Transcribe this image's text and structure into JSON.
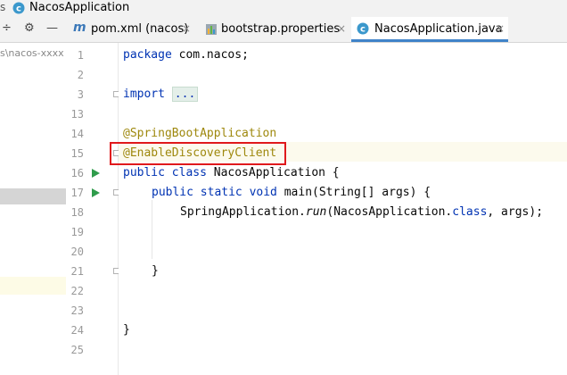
{
  "breadcrumb": {
    "separator": "s",
    "class_name": "NacosApplication"
  },
  "tabs": [
    {
      "label": "pom.xml (nacos)",
      "icon": "maven-m-icon",
      "close": "×"
    },
    {
      "label": "bootstrap.properties",
      "icon": "properties-file-icon",
      "close": "×"
    },
    {
      "label": "NacosApplication.java",
      "icon": "java-class-icon",
      "close": "×",
      "active": true
    }
  ],
  "toolbar": {
    "collapse_glyph": "÷",
    "settings_glyph": "⚙",
    "minimize_glyph": "—"
  },
  "project": {
    "path": "s\\nacos-xxxx"
  },
  "gutter": {
    "line_numbers": [
      "1",
      "2",
      "3",
      "13",
      "14",
      "15",
      "16",
      "17",
      "18",
      "19",
      "20",
      "21",
      "22",
      "23",
      "24",
      "25"
    ]
  },
  "code": {
    "l1_kw": "package",
    "l1_rest": " com.nacos;",
    "l3_kw": "import",
    "l3_fold": "...",
    "l14_ann": "@SpringBootApplication",
    "l15_ann": "@EnableDiscoveryClient",
    "l16_kw": "public class",
    "l16_rest": " NacosApplication {",
    "l17_kw": "public static void",
    "l17_rest": " main(String[] args) {",
    "l18_a": "SpringApplication.",
    "l18_run": "run",
    "l18_b": "(NacosApplication.",
    "l18_class": "class",
    "l18_c": ", args);",
    "l21_brace": "}",
    "l23_brace": "}"
  },
  "colors": {
    "keyword": "#0033b3",
    "annotation": "#9e880d",
    "highlight_box": "#e0191c",
    "active_tab_underline": "#4083c9"
  }
}
